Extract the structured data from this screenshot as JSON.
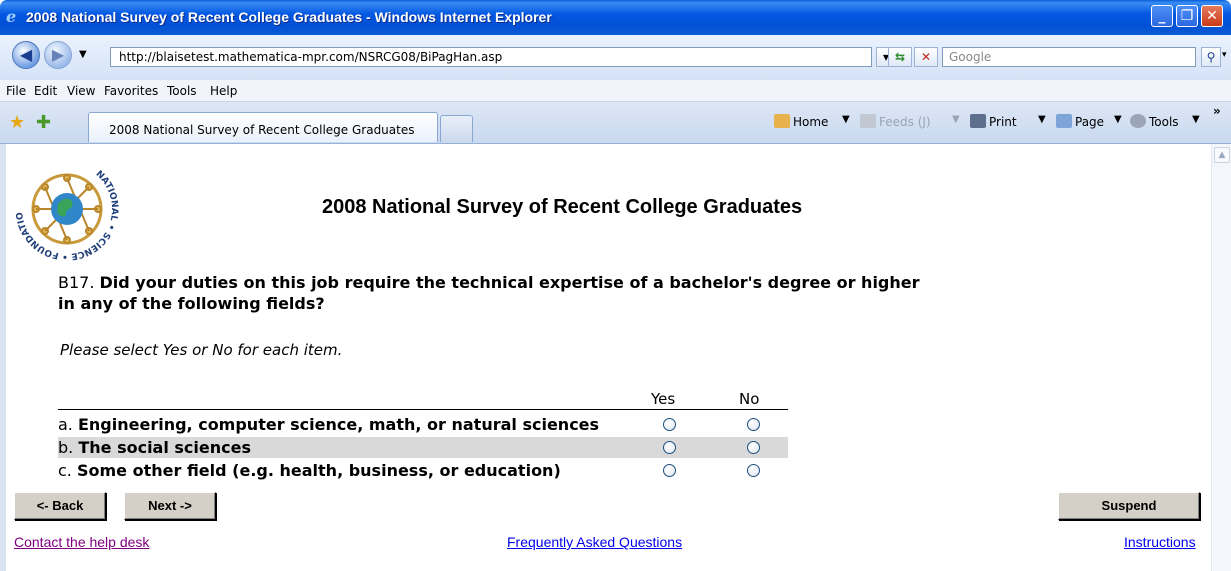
{
  "window": {
    "title": "2008 National Survey of Recent College Graduates - Windows Internet Explorer",
    "minimize_glyph": "_",
    "restore_glyph": "❐",
    "close_glyph": "✕"
  },
  "address_bar": {
    "url": "http://blaisetest.mathematica-mpr.com/NSRCG08/BiPagHan.asp",
    "search_placeholder": "Google"
  },
  "menu": [
    "File",
    "Edit",
    "View",
    "Favorites",
    "Tools",
    "Help"
  ],
  "tab": {
    "label": "2008 National Survey of Recent College Graduates"
  },
  "command_bar": {
    "home": "Home",
    "feeds": "Feeds (J)",
    "print": "Print",
    "page": "Page",
    "tools": "Tools",
    "overflow": "»"
  },
  "logo": {
    "text": "NATIONAL • SCIENCE • FOUNDATION"
  },
  "page": {
    "heading": "2008 National Survey of Recent College Graduates"
  },
  "question": {
    "number": "B17.",
    "text": "Did your duties on this job require the technical expertise of a bachelor's degree or higher in any of the following fields?",
    "instruction": "Please select Yes or No for each item."
  },
  "grid": {
    "columns": [
      "Yes",
      "No"
    ],
    "rows": [
      {
        "letter": "a.",
        "label": "Engineering, computer science, math, or natural sciences"
      },
      {
        "letter": "b.",
        "label": "The social sciences"
      },
      {
        "letter": "c.",
        "label": "Some other field (e.g. health, business, or education)"
      }
    ]
  },
  "buttons": {
    "back": "<- Back",
    "next": "Next ->",
    "suspend": "Suspend"
  },
  "footer": {
    "help_desk": "Contact the help desk",
    "faq": "Frequently Asked Questions",
    "instructions": "Instructions"
  },
  "colors": {
    "titlebar": "#0250d6",
    "shaded_row": "#d9d9d9",
    "button_face": "#d4d0c8",
    "visited_link": "#800080",
    "link": "#0000ee"
  }
}
